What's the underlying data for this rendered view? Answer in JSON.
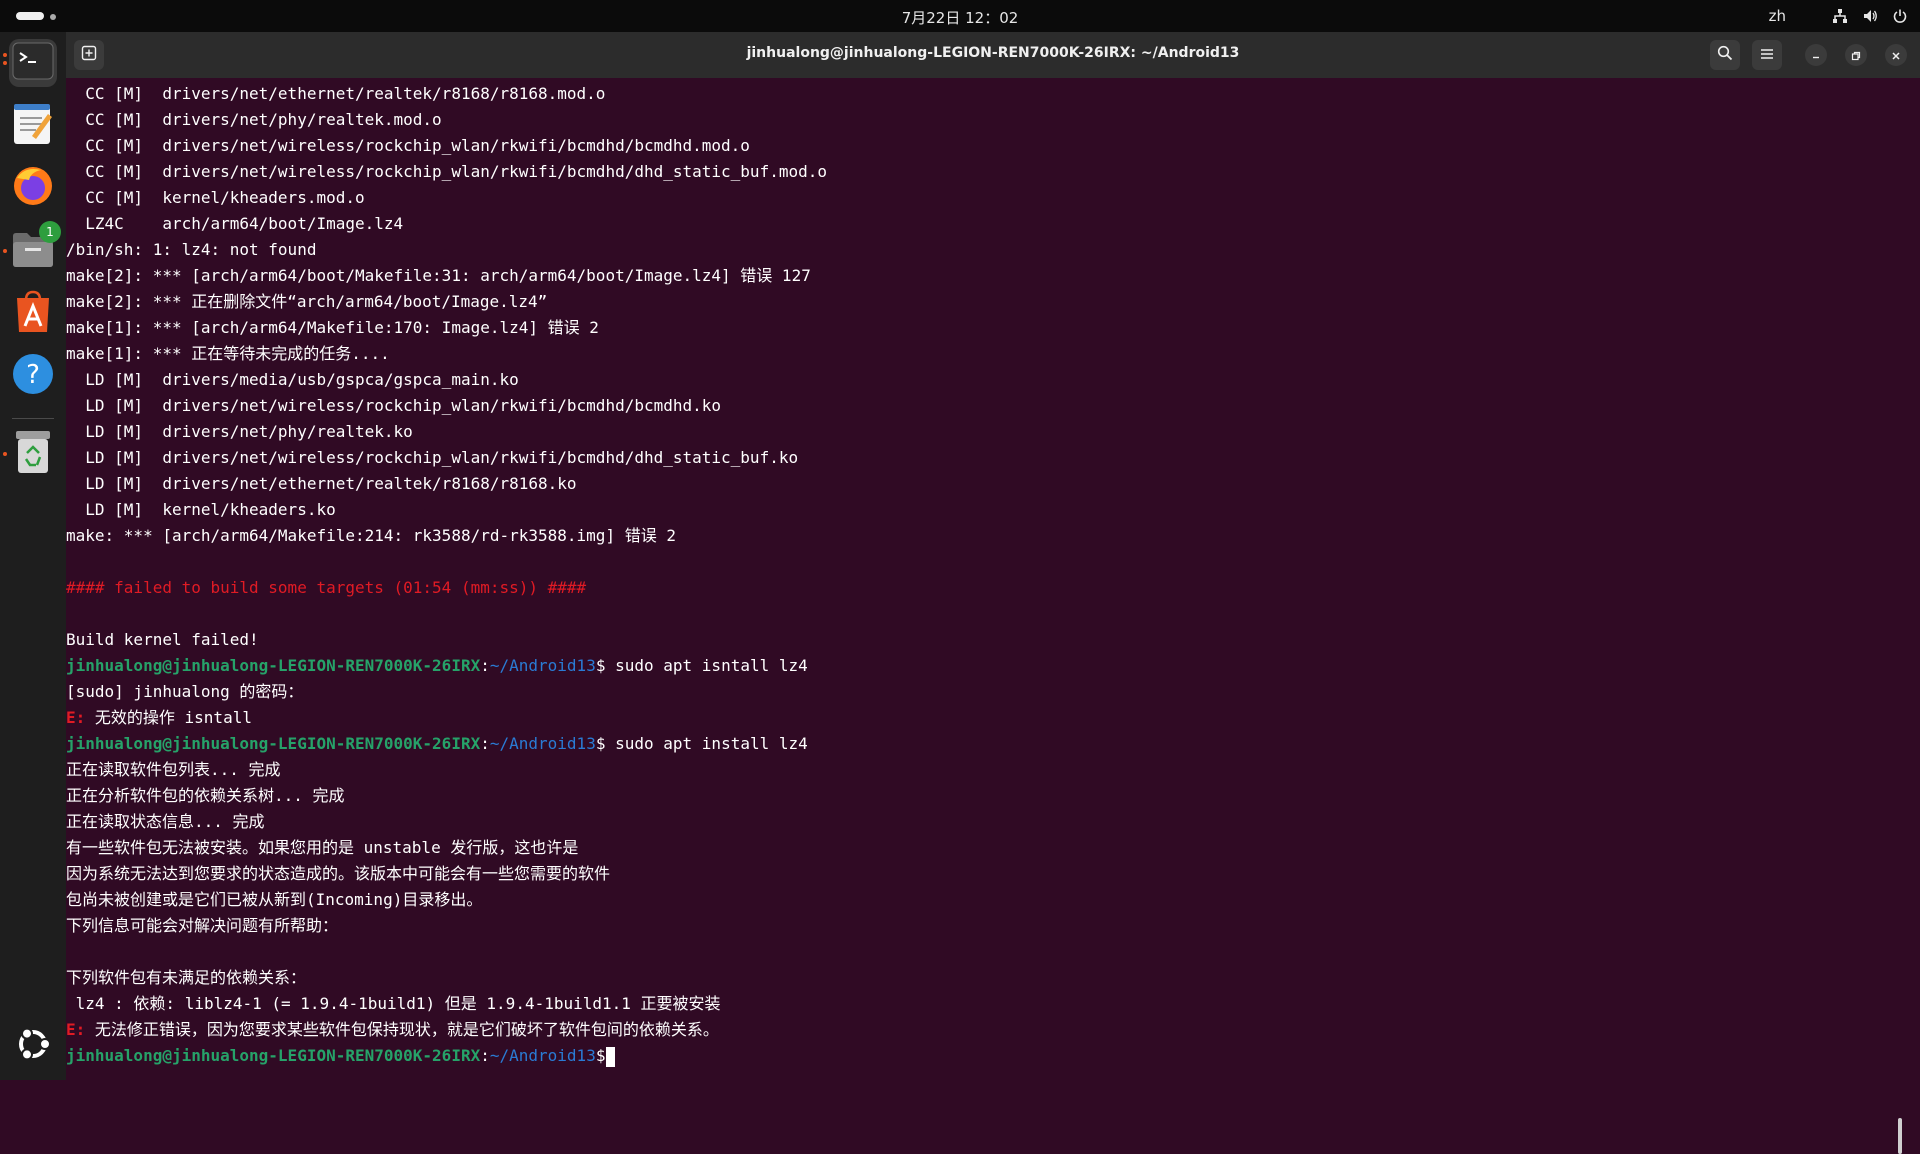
{
  "topbar": {
    "clock": "7月22日 12：02",
    "input_method": "zh"
  },
  "dock": {
    "items": [
      {
        "name": "terminal",
        "icon": "terminal-icon",
        "active": true,
        "running": true
      },
      {
        "name": "text-editor",
        "icon": "text-editor-icon",
        "active": false,
        "running": false
      },
      {
        "name": "firefox",
        "icon": "firefox-icon",
        "active": false,
        "running": false
      },
      {
        "name": "files",
        "icon": "files-icon",
        "active": false,
        "running": true,
        "badge": "1"
      },
      {
        "name": "app-center",
        "icon": "app-center-icon",
        "active": false,
        "running": false
      },
      {
        "name": "help",
        "icon": "help-icon",
        "active": false,
        "running": false
      },
      {
        "name": "trash",
        "icon": "trash-icon",
        "active": false,
        "running": true
      },
      {
        "name": "show-apps",
        "icon": "ubuntu-logo-icon",
        "active": false,
        "running": false
      }
    ]
  },
  "window": {
    "title": "jinhualong@jinhualong-LEGION-REN7000K-26IRX: ~/Android13"
  },
  "prompt": {
    "user_host": "jinhualong@jinhualong-LEGION-REN7000K-26IRX",
    "path": "~/Android13"
  },
  "colors": {
    "terminal_bg": "#300a24",
    "prompt_user": "#26a269",
    "prompt_path": "#2a7bd4",
    "error": "#e01b24"
  },
  "terminal": {
    "lines": [
      {
        "text": "  CC [M]  drivers/net/ethernet/realtek/r8168/r8168.mod.o"
      },
      {
        "text": "  CC [M]  drivers/net/phy/realtek.mod.o"
      },
      {
        "text": "  CC [M]  drivers/net/wireless/rockchip_wlan/rkwifi/bcmdhd/bcmdhd.mod.o"
      },
      {
        "text": "  CC [M]  drivers/net/wireless/rockchip_wlan/rkwifi/bcmdhd/dhd_static_buf.mod.o"
      },
      {
        "text": "  CC [M]  kernel/kheaders.mod.o"
      },
      {
        "text": "  LZ4C    arch/arm64/boot/Image.lz4"
      },
      {
        "text": "/bin/sh: 1: lz4: not found"
      },
      {
        "text": "make[2]: *** [arch/arm64/boot/Makefile:31: arch/arm64/boot/Image.lz4] 错误 127"
      },
      {
        "text": "make[2]: *** 正在删除文件“arch/arm64/boot/Image.lz4”"
      },
      {
        "text": "make[1]: *** [arch/arm64/Makefile:170: Image.lz4] 错误 2"
      },
      {
        "text": "make[1]: *** 正在等待未完成的任务...."
      },
      {
        "text": "  LD [M]  drivers/media/usb/gspca/gspca_main.ko"
      },
      {
        "text": "  LD [M]  drivers/net/wireless/rockchip_wlan/rkwifi/bcmdhd/bcmdhd.ko"
      },
      {
        "text": "  LD [M]  drivers/net/phy/realtek.ko"
      },
      {
        "text": "  LD [M]  drivers/net/wireless/rockchip_wlan/rkwifi/bcmdhd/dhd_static_buf.ko"
      },
      {
        "text": "  LD [M]  drivers/net/ethernet/realtek/r8168/r8168.ko"
      },
      {
        "text": "  LD [M]  kernel/kheaders.ko"
      },
      {
        "text": "make: *** [arch/arm64/Makefile:214: rk3588/rd-rk3588.img] 错误 2"
      },
      {
        "text": ""
      },
      {
        "type": "error",
        "text": "#### failed to build some targets (01:54 (mm:ss)) ####"
      },
      {
        "text": ""
      },
      {
        "text": "Build kernel failed!"
      },
      {
        "type": "prompt",
        "text": " sudo apt isntall lz4"
      },
      {
        "text": "[sudo] jinhualong 的密码："
      },
      {
        "type": "e",
        "text": " 无效的操作 isntall"
      },
      {
        "type": "prompt",
        "text": " sudo apt install lz4"
      },
      {
        "text": "正在读取软件包列表... 完成"
      },
      {
        "text": "正在分析软件包的依赖关系树... 完成"
      },
      {
        "text": "正在读取状态信息... 完成"
      },
      {
        "text": "有一些软件包无法被安装。如果您用的是 unstable 发行版，这也许是"
      },
      {
        "text": "因为系统无法达到您要求的状态造成的。该版本中可能会有一些您需要的软件"
      },
      {
        "text": "包尚未被创建或是它们已被从新到(Incoming)目录移出。"
      },
      {
        "text": "下列信息可能会对解决问题有所帮助："
      },
      {
        "text": ""
      },
      {
        "text": "下列软件包有未满足的依赖关系："
      },
      {
        "text": " lz4 : 依赖: liblz4-1 (= 1.9.4-1build1) 但是 1.9.4-1build1.1 正要被安装"
      },
      {
        "type": "e",
        "text": " 无法修正错误，因为您要求某些软件包保持现状，就是它们破坏了软件包间的依赖关系。"
      },
      {
        "type": "prompt",
        "text": ""
      }
    ]
  }
}
